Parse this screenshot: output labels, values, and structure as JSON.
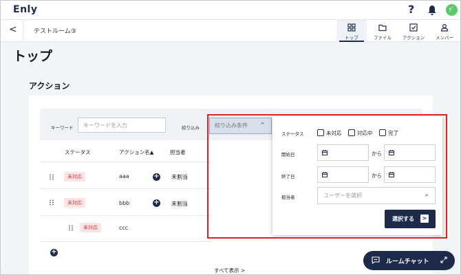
{
  "header": {
    "logo": "Enly",
    "help": "?",
    "avatar_initial": "ｹﾞ"
  },
  "roombar": {
    "back": "<",
    "room_name": "テストルーム③",
    "tabs": [
      {
        "label": "トップ",
        "icon": "grid-icon",
        "active": true
      },
      {
        "label": "ファイル",
        "icon": "folder-icon",
        "active": false
      },
      {
        "label": "アクション",
        "icon": "checkbox-icon",
        "active": false
      },
      {
        "label": "メンバー",
        "icon": "person-icon",
        "active": false
      }
    ]
  },
  "page": {
    "title": "トップ",
    "section_title": "アクション"
  },
  "filter": {
    "keyword_label": "キーワード",
    "keyword_placeholder": "キーワードを入力",
    "narrow_label": "絞り込み",
    "narrow_value": "絞り込み条件",
    "narrow_chevron": "^"
  },
  "table": {
    "headers": {
      "status": "ステータス",
      "name": "アクション名▲",
      "assignee": "担当者"
    },
    "rows": [
      {
        "status": "未対応",
        "name": "aaa",
        "assignee": "未割当"
      },
      {
        "status": "未対応",
        "name": "bbb",
        "assignee": "未割当"
      },
      {
        "status": "未対応",
        "name": "ccc",
        "assignee": ""
      }
    ],
    "add": "+",
    "show_all": "すべて表示 >"
  },
  "panel": {
    "status_label": "ステータス",
    "status_options": [
      "未対応",
      "対応中",
      "完了"
    ],
    "start_label": "開始日",
    "end_label": "終了日",
    "range_sep": "から",
    "assignee_label": "担当者",
    "assignee_placeholder": "ユーザーを選択",
    "chevron": "⌄",
    "submit": "選択する",
    "submit_arrow": ">"
  },
  "chat": {
    "label": "ルームチャット"
  },
  "colors": {
    "navy": "#1d2a4a",
    "highlight": "#e51e1e",
    "badge_bg": "#fbe4e4",
    "badge_text": "#d23b3b"
  }
}
